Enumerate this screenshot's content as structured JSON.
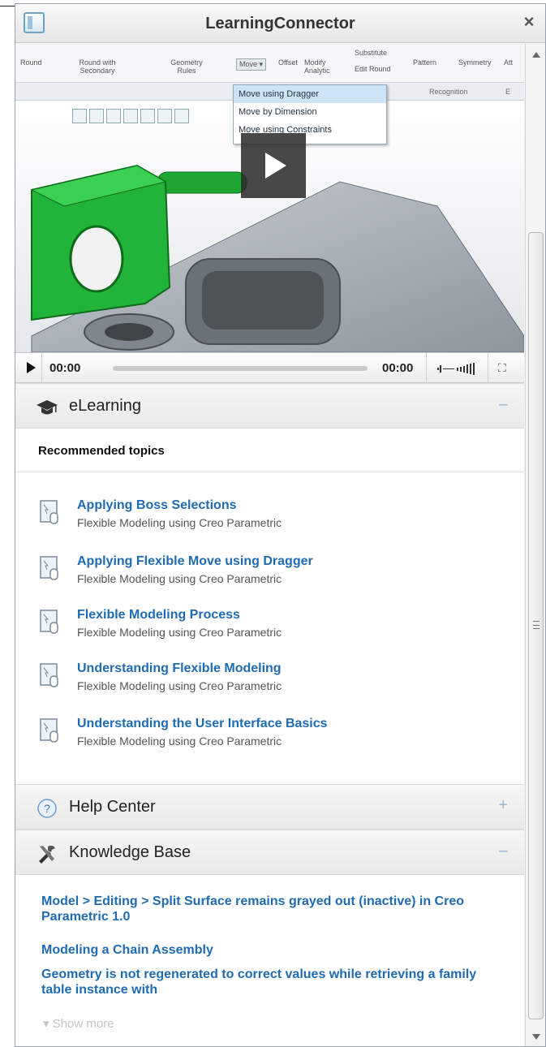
{
  "window": {
    "title": "LearningConnector",
    "close_label": "×"
  },
  "video": {
    "ribbon_labels": [
      "Round",
      "Round with Secondary",
      "Geometry Rules",
      "Move ▾",
      "Offset",
      "Modify Analytic",
      "Substitute",
      "Edit Round",
      "Pattern",
      "Symmetry",
      "Att"
    ],
    "ribbon_groups": [
      "Recognition",
      "E"
    ],
    "move_menu": [
      "Move using Dragger",
      "Move by Dimension",
      "Move using Constraints"
    ],
    "controls": {
      "time_current": "00:00",
      "time_total": "00:00"
    }
  },
  "elearning": {
    "title": "eLearning",
    "toggle": "–",
    "subheader": "Recommended topics",
    "topics": [
      {
        "title": "Applying Boss Selections",
        "subtitle": "Flexible Modeling using Creo Parametric"
      },
      {
        "title": "Applying Flexible Move using Dragger",
        "subtitle": "Flexible Modeling using Creo Parametric"
      },
      {
        "title": "Flexible Modeling Process",
        "subtitle": "Flexible Modeling using Creo Parametric"
      },
      {
        "title": "Understanding Flexible Modeling",
        "subtitle": "Flexible Modeling using Creo Parametric"
      },
      {
        "title": "Understanding the User Interface Basics",
        "subtitle": "Flexible Modeling using Creo Parametric"
      }
    ]
  },
  "help_center": {
    "title": "Help Center",
    "toggle": "+"
  },
  "knowledge_base": {
    "title": "Knowledge Base",
    "toggle": "–",
    "links": [
      "Model > Editing > Split Surface remains grayed out (inactive) in Creo Parametric 1.0",
      "Modeling a Chain Assembly",
      "Geometry is not regenerated to correct values while retrieving a family table instance with"
    ],
    "show_more": "▾ Show more"
  },
  "colors": {
    "link": "#1f6bb3",
    "model_green": "#22b33a",
    "toggle": "#9ab7d3"
  }
}
